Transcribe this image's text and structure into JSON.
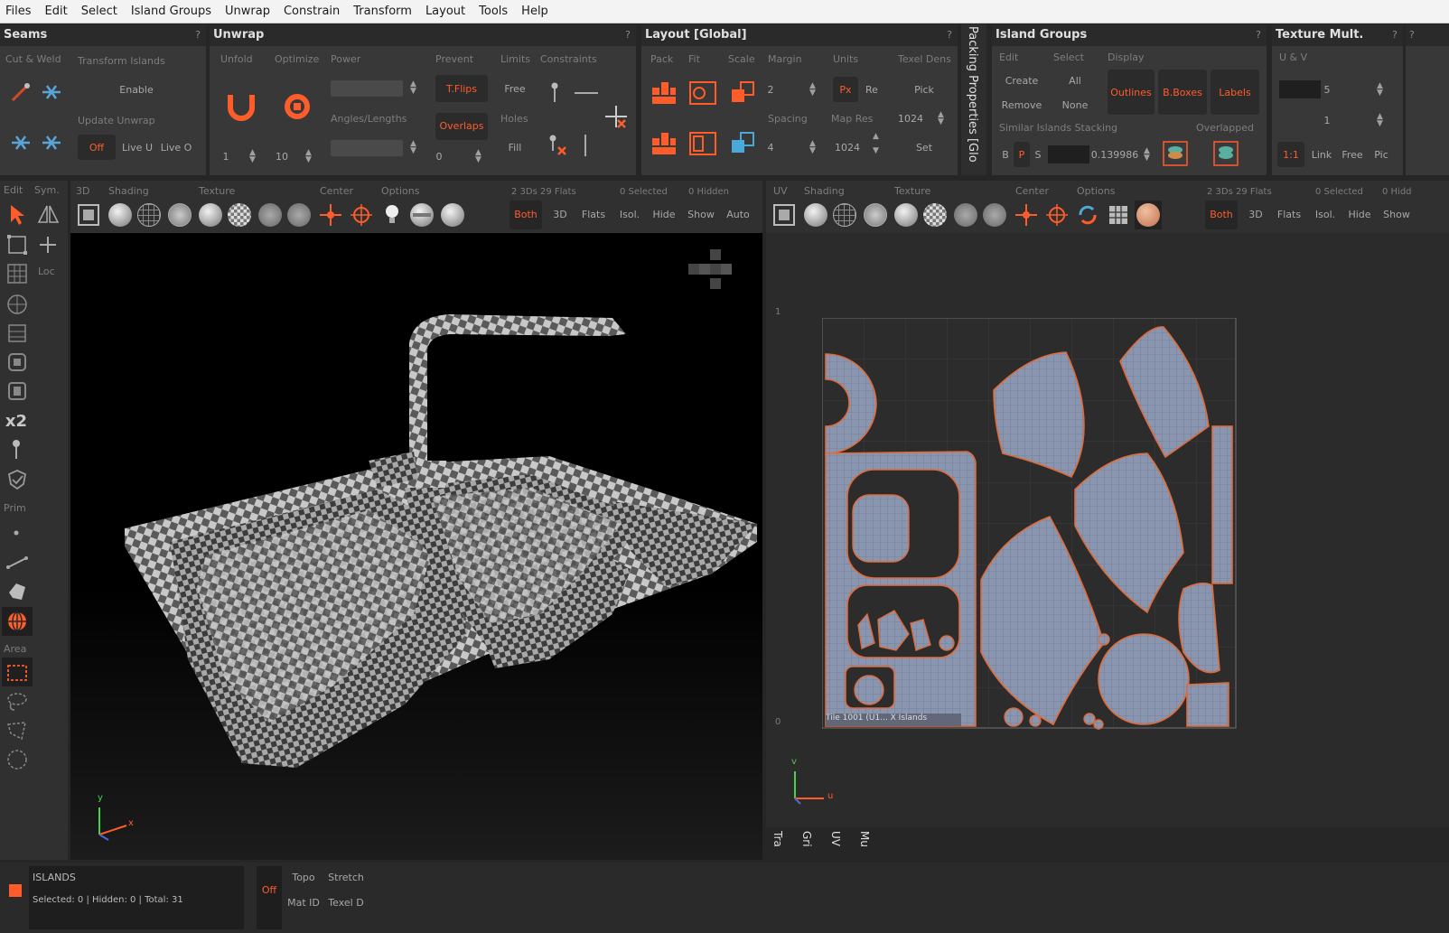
{
  "menu": [
    "Files",
    "Edit",
    "Select",
    "Island Groups",
    "Unwrap",
    "Constrain",
    "Transform",
    "Layout",
    "Tools",
    "Help"
  ],
  "seams": {
    "title": "Seams",
    "help": "?",
    "cut_weld": "Cut & Weld",
    "transform_islands": "Transform Islands",
    "enable": "Enable",
    "update_unwrap": "Update Unwrap",
    "off": "Off",
    "live_u": "Live U",
    "live_o": "Live O"
  },
  "unwrap": {
    "title": "Unwrap",
    "help": "?",
    "unfold": "Unfold",
    "optimize": "Optimize",
    "power": "Power",
    "angles_lengths": "Angles/Lengths",
    "prevent": "Prevent",
    "t_flips": "T.Flips",
    "overlaps": "Overlaps",
    "limits": "Limits",
    "constraints": "Constraints",
    "free": "Free",
    "holes": "Holes",
    "fill": "Fill",
    "v1": "1",
    "v2": "10",
    "v3": "0"
  },
  "layout": {
    "title": "Layout [Global]",
    "help": "?",
    "pack": "Pack",
    "fit": "Fit",
    "scale": "Scale",
    "margin": "Margin",
    "margin_val": "2",
    "spacing": "Spacing",
    "spacing_val": "4",
    "units": "Units",
    "px": "Px",
    "re": "Re",
    "map_res": "Map Res",
    "map_res_val": "1024",
    "map_res_val2": "1024",
    "texel_dens": "Texel Dens",
    "pick": "Pick",
    "set": "Set"
  },
  "packing_props": "Packing Properties [Glo",
  "island_groups": {
    "title": "Island Groups",
    "help": "?",
    "edit": "Edit",
    "select": "Select",
    "display": "Display",
    "create": "Create",
    "all": "All",
    "remove": "Remove",
    "none": "None",
    "outlines": "Outlines",
    "bboxes": "B.Boxes",
    "labels": "Labels",
    "similar_stacking": "Similar Islands Stacking",
    "overlapped": "Overlapped",
    "b": "B",
    "p": "P",
    "s": "S",
    "value": "0.139986"
  },
  "texture_mult": {
    "title": "Texture Mult.",
    "help": "?",
    "u_v": "U & V",
    "v1": "5",
    "v2": "1",
    "ratio": "1:1",
    "link": "Link",
    "free": "Free",
    "pic": "Pic"
  },
  "left_tools": {
    "edit": "Edit",
    "sym": "Sym.",
    "loc": "Loc",
    "x2": "x2",
    "prim": "Prim",
    "area": "Area"
  },
  "viewport3d": {
    "tab": "3D",
    "shading": "Shading",
    "texture": "Texture",
    "center": "Center",
    "options": "Options",
    "stats": "2 3Ds 29 Flats",
    "selected": "0 Selected",
    "hidden": "0 Hidden",
    "both": "Both",
    "d3": "3D",
    "flats": "Flats",
    "isol": "Isol.",
    "hide": "Hide",
    "show": "Show",
    "auto": "Auto",
    "axis_y": "y",
    "axis_x": "x"
  },
  "viewportuv": {
    "tab": "UV",
    "shading": "Shading",
    "texture": "Texture",
    "center": "Center",
    "options": "Options",
    "stats": "2 3Ds 29 Flats",
    "selected": "0 Selected",
    "hidden": "0 Hidd",
    "both": "Both",
    "d3": "3D",
    "flats": "Flats",
    "isol": "Isol.",
    "hide": "Hide",
    "show": "Show",
    "tile_label": "Tile 1001 (U1...     X  Islands",
    "y1": "1",
    "y0": "0",
    "axis_v": "v",
    "axis_u": "u"
  },
  "uv_side_tabs": [
    "Tra",
    "Gri",
    "UV",
    "Mu"
  ],
  "status": {
    "mode": "ISLANDS",
    "info": "Selected: 0 | Hidden: 0 | Total: 31",
    "off": "Off",
    "topo": "Topo",
    "stretch": "Stretch",
    "mat_id": "Mat ID",
    "texel_d": "Texel D"
  },
  "colors": {
    "accent": "#ff5c2c",
    "panel": "#383838",
    "title": "#2a2a2a",
    "uv_island": "#8a96b0",
    "uv_outline": "#e06a3a"
  }
}
